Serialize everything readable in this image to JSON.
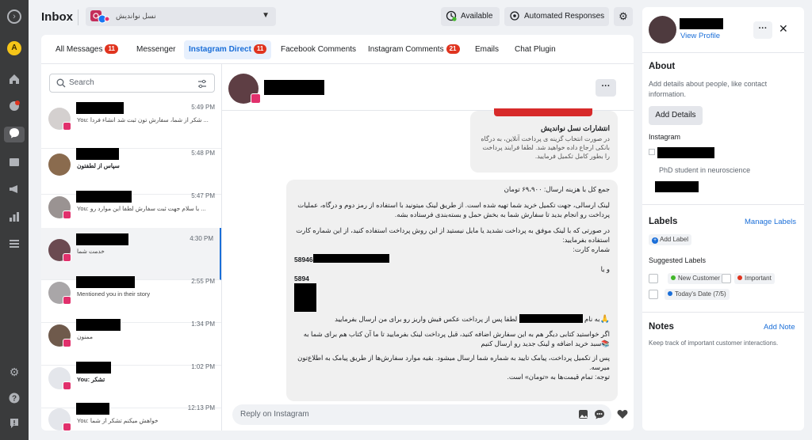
{
  "header": {
    "title": "Inbox",
    "page_name": "نسل نوانديش",
    "available_label": "Available",
    "automated_label": "Automated Responses"
  },
  "tabs": [
    {
      "label": "All Messages",
      "count": "11"
    },
    {
      "label": "Messenger",
      "count": ""
    },
    {
      "label": "Instagram Direct",
      "count": "11"
    },
    {
      "label": "Facebook Comments",
      "count": ""
    },
    {
      "label": "Instagram Comments",
      "count": "21"
    },
    {
      "label": "Emails",
      "count": ""
    },
    {
      "label": "Chat Plugin",
      "count": ""
    }
  ],
  "search": {
    "placeholder": "Search"
  },
  "conversations": [
    {
      "time": "5:49 PM",
      "snippet": "You: شکر از شما، سفارش تون ثبت شد انشاء فردا ..."
    },
    {
      "time": "5:48 PM",
      "snippet": "سپاس از لطفتون"
    },
    {
      "time": "5:47 PM",
      "snippet": "You: با سلام جهت ثبت سفارش لطفا این موارد رو ..."
    },
    {
      "time": "4:30 PM",
      "snippet": "خدمت شما"
    },
    {
      "time": "2:55 PM",
      "snippet": "Mentioned you in their story"
    },
    {
      "time": "1:34 PM",
      "snippet": "ممنون"
    },
    {
      "time": "1:02 PM",
      "snippet": "You: تشکر"
    },
    {
      "time": "12:13 PM",
      "snippet": "You: خواهش میکنم تشکر از شما"
    }
  ],
  "chat": {
    "card_title": "انتشارات نسل نوانديش",
    "card_body": "در صورت انتخاب گزینه ی پرداخت آنلاین، به درگاه بانکی ارجاع داده خواهید شد. لطفا فرایند پرداخت را بطور کامل تکمیل فرمایید.",
    "msg_lines": [
      "جمع کل با هزینه ارسال: ۶۹،۹۰۰ تومان",
      "لینک ارسالی، جهت تکمیل خرید شما تهیه شده است. از طریق لینک میتونید با استفاده از رمز دوم و درگاه، عملیات",
      "پرداخت رو انجام بدید تا سفارش شما به بخش حمل و بسته‌بندی فرستاده بشه.",
      "در صورتی که با لینک موفق به پرداخت نشدید یا مایل نیستید از این روش پرداخت استفاده کنید، از این شماره کارت",
      "استفاده بفرمایید:",
      "شماره کارت:",
      "58946",
      "و یا",
      "5894",
      "به نام",
      "لطفا پس از پرداخت عکس فیش واریز رو برای من ارسال بفرمایید",
      "اگر خواستید کتابی دیگر هم به این سفارش اضافه کنید، قبل پرداخت لینک بفرمایید تا ما آن کتاب هم برای شما به",
      "سبد خرید اضافه و لینک جدید رو ارسال کنیم",
      "پس از تکمیل پرداخت، پیامک تایید به شماره شما ارسال میشود. بقیه موارد سفارش‌ها از طریق پیامک به اطلاع‌تون",
      "میرسه.",
      "توجه: تمام قیمت‌ها به «تومان» است."
    ],
    "reply_placeholder": "Reply on Instagram"
  },
  "profile": {
    "view_profile": "View Profile",
    "about_title": "About",
    "about_desc": "Add details about people, like contact information.",
    "add_details": "Add Details",
    "instagram_label": "Instagram",
    "bio": "PhD student in neuroscience",
    "labels_title": "Labels",
    "manage_labels": "Manage Labels",
    "add_label": "Add Label",
    "suggested_title": "Suggested Labels",
    "suggested": [
      {
        "label": "New Customer",
        "color": "#42b72a"
      },
      {
        "label": "Important",
        "color": "#e0341f"
      },
      {
        "label": "Today's Date (7/5)",
        "color": "#1a6ed8"
      }
    ],
    "notes_title": "Notes",
    "add_note": "Add Note",
    "notes_desc": "Keep track of important customer interactions."
  },
  "colors": {
    "accent": "#1a6ed8",
    "badge": "#e0341f",
    "rail": "#3a3b3c",
    "instagram": "#e1306c"
  }
}
